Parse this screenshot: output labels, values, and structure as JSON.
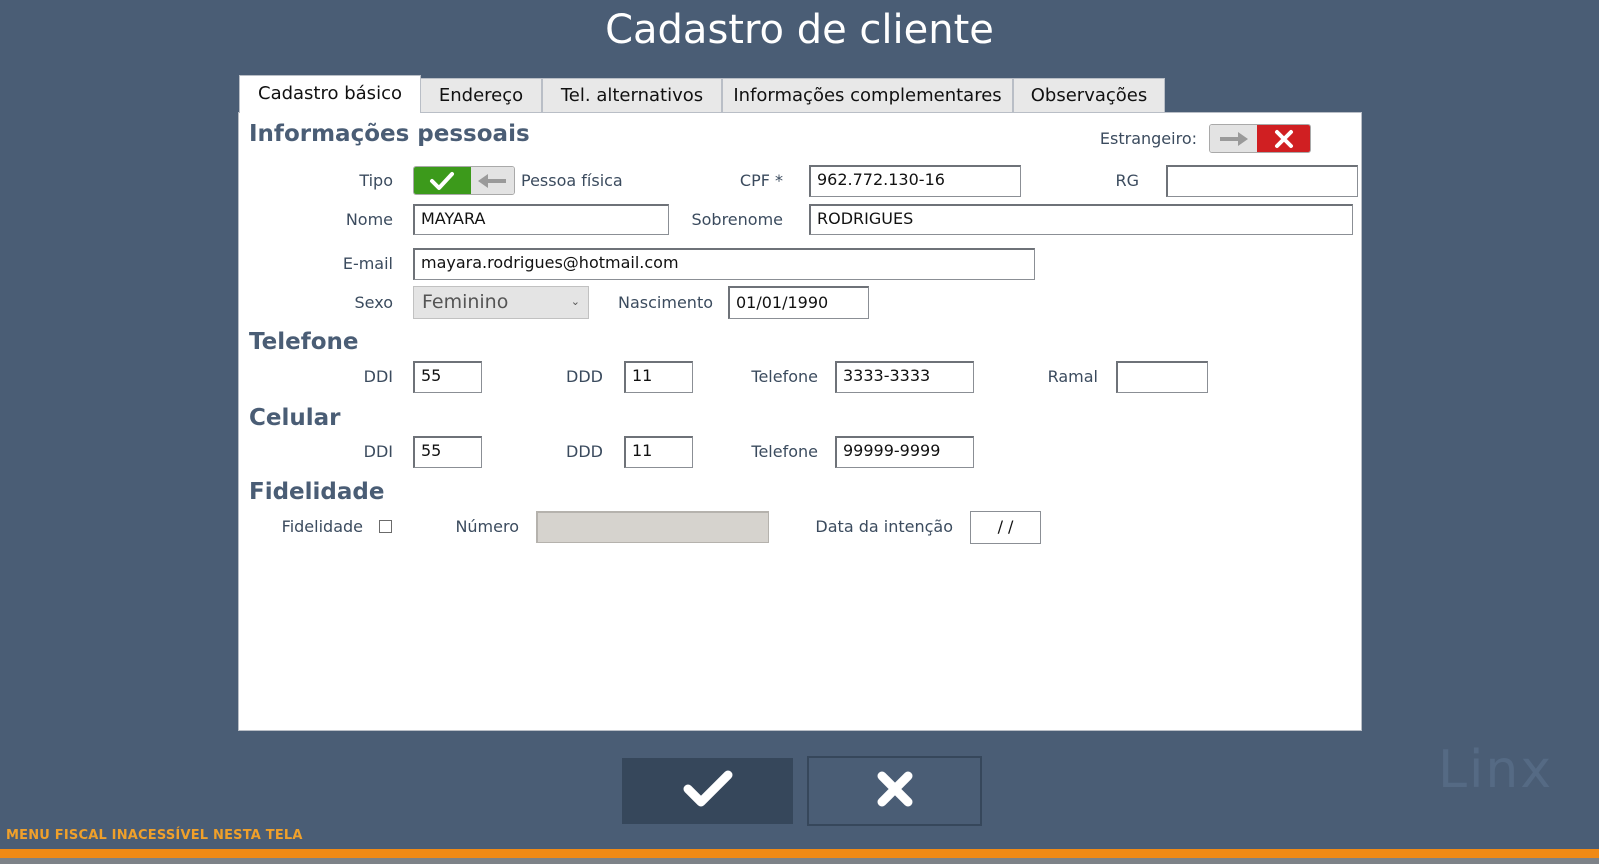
{
  "window": {
    "title": "Cadastro de cliente"
  },
  "tabs": [
    {
      "label": "Cadastro básico",
      "active": true
    },
    {
      "label": "Endereço",
      "active": false
    },
    {
      "label": "Tel. alternativos",
      "active": false
    },
    {
      "label": "Informações complementares",
      "active": false
    },
    {
      "label": "Observações",
      "active": false
    }
  ],
  "personal": {
    "heading": "Informações pessoais",
    "estrangeiro_label": "Estrangeiro:",
    "estrangeiro_value": false,
    "tipo_label": "Tipo",
    "tipo_value": "Pessoa física",
    "cpf_label": "CPF *",
    "cpf_value": "962.772.130-16",
    "rg_label": "RG",
    "rg_value": "",
    "nome_label": "Nome",
    "nome_value": "MAYARA",
    "sobrenome_label": "Sobrenome",
    "sobrenome_value": "RODRIGUES",
    "email_label": "E-mail",
    "email_value": "mayara.rodrigues@hotmail.com",
    "sexo_label": "Sexo",
    "sexo_value": "Feminino",
    "nascimento_label": "Nascimento",
    "nascimento_value": "01/01/1990"
  },
  "telefone": {
    "heading": "Telefone",
    "ddi_label": "DDI",
    "ddi_value": "55",
    "ddd_label": "DDD",
    "ddd_value": "11",
    "telefone_label": "Telefone",
    "telefone_value": "3333-3333",
    "ramal_label": "Ramal",
    "ramal_value": ""
  },
  "celular": {
    "heading": "Celular",
    "ddi_label": "DDI",
    "ddi_value": "55",
    "ddd_label": "DDD",
    "ddd_value": "11",
    "telefone_label": "Telefone",
    "telefone_value": "99999-9999"
  },
  "fidelidade": {
    "heading": "Fidelidade",
    "fidelidade_label": "Fidelidade",
    "fidelidade_checked": false,
    "numero_label": "Número",
    "numero_value": "",
    "data_label": "Data da intenção",
    "data_value": " /  /"
  },
  "footer": {
    "status": "MENU FISCAL INACESSÍVEL NESTA TELA",
    "logo": "Linx"
  },
  "colors": {
    "background": "#4a5d75",
    "accent_orange": "#f08a16",
    "toggle_green": "#3c9a1b",
    "toggle_red": "#d01f22"
  }
}
